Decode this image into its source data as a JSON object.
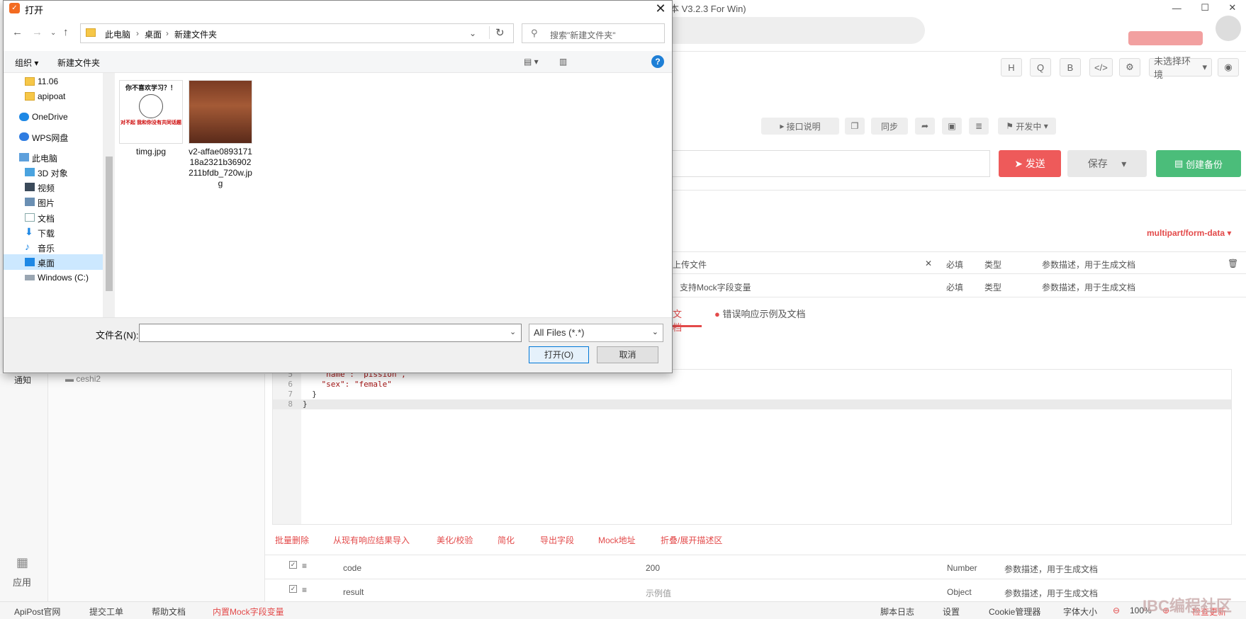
{
  "app": {
    "title": "本 V3.2.3 For Win)",
    "window_controls": [
      "—",
      "☐",
      "✕"
    ],
    "toolbar_buttons": [
      "H",
      "Q",
      "B",
      "</>",
      "⚙"
    ],
    "env_select": "未选择环境",
    "mid_buttons": [
      "接口说明",
      "同步",
      "开发中"
    ],
    "send": "发送",
    "save": "保存",
    "backup": "创建备份",
    "body_type": "multipart/form-data",
    "params": [
      {
        "name": "上传文件",
        "required": "必填",
        "type": "类型",
        "desc": "参数描述，用于生成文档"
      },
      {
        "name": "支持Mock字段变量",
        "required": "必填",
        "type": "类型",
        "desc": "参数描述，用于生成文档"
      }
    ],
    "tabs": [
      "文档",
      "错误响应示例及文档"
    ],
    "left_nav_label": "通知",
    "app_label": "应用",
    "tree_item": "ceshi2",
    "code_lines": [
      {
        "n": "5",
        "text": "    \"name\": \"pission\","
      },
      {
        "n": "6",
        "text": "    \"sex\": \"female\""
      },
      {
        "n": "7",
        "text": "  }"
      },
      {
        "n": "8",
        "text": "}"
      }
    ],
    "ops": [
      "批量删除",
      "从现有响应结果导入",
      "美化/校验",
      "简化",
      "导出字段",
      "Mock地址",
      "折叠/展开描述区"
    ],
    "resp_rows": [
      {
        "name": "code",
        "value": "200",
        "type": "Number",
        "desc": "参数描述，用于生成文档"
      },
      {
        "name": "result",
        "value": "示例值",
        "type": "Object",
        "desc": "参数描述，用于生成文档"
      }
    ],
    "status_left": [
      "ApiPost官网",
      "提交工单",
      "帮助文档",
      "内置Mock字段变量"
    ],
    "status_right": [
      "脚本日志",
      "设置",
      "Cookie管理器",
      "字体大小",
      "100%",
      "检查更新"
    ],
    "watermark": "IBC编程社区"
  },
  "dialog": {
    "title": "打开",
    "breadcrumbs": [
      "此电脑",
      "桌面",
      "新建文件夹"
    ],
    "search_placeholder": "搜索\"新建文件夹\"",
    "organize": "组织 ▾",
    "new_folder": "新建文件夹",
    "nav_items": [
      {
        "label": "11.06",
        "icon": "folder-icon"
      },
      {
        "label": "apipoat",
        "icon": "folder-icon"
      },
      {
        "label": "OneDrive",
        "icon": "cloud-icon"
      },
      {
        "label": "WPS网盘",
        "icon": "cloud-icon"
      },
      {
        "label": "此电脑",
        "icon": "computer-icon"
      },
      {
        "label": "3D 对象",
        "icon": "cube-icon"
      },
      {
        "label": "视频",
        "icon": "video-icon"
      },
      {
        "label": "图片",
        "icon": "picture-icon"
      },
      {
        "label": "文档",
        "icon": "document-icon"
      },
      {
        "label": "下载",
        "icon": "download-icon"
      },
      {
        "label": "音乐",
        "icon": "music-icon"
      },
      {
        "label": "桌面",
        "icon": "desktop-icon"
      },
      {
        "label": "Windows (C:)",
        "icon": "drive-icon"
      }
    ],
    "files": [
      {
        "name": "timg.jpg",
        "caption_top": "你不喜欢学习？！",
        "caption_bottom": "对不起 我和你没有共同话题"
      },
      {
        "name": "v2-affae089317118a2321b36902211bfdb_720w.jpg"
      }
    ],
    "filename_label": "文件名(N):",
    "filename_value": "",
    "filetype": "All Files (*.*)",
    "open": "打开(O)",
    "cancel": "取消"
  }
}
